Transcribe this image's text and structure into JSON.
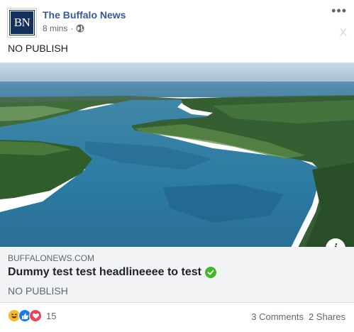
{
  "post": {
    "page_name": "The Buffalo News",
    "avatar_text": "BN",
    "timestamp": "8 mins",
    "separator": "·",
    "privacy_icon": "globe-icon",
    "more_icon": "•••",
    "hide_label": "X",
    "text": "NO PUBLISH"
  },
  "link_preview": {
    "domain": "BUFFALONEWS.COM",
    "headline": "Dummy test test headlineeee to test",
    "subtitle": "NO PUBLISH",
    "info_label": "i"
  },
  "footer": {
    "reaction_icons": [
      "haha-icon",
      "like-icon",
      "love-icon"
    ],
    "reaction_count": "15",
    "comments": "3 Comments",
    "shares": "2 Shares"
  },
  "colors": {
    "brand_blue": "#385898",
    "avatar_navy": "#14305c",
    "link_box_bg": "#f2f3f5",
    "verified_green": "#42b72a",
    "secondary_text": "#606770"
  }
}
